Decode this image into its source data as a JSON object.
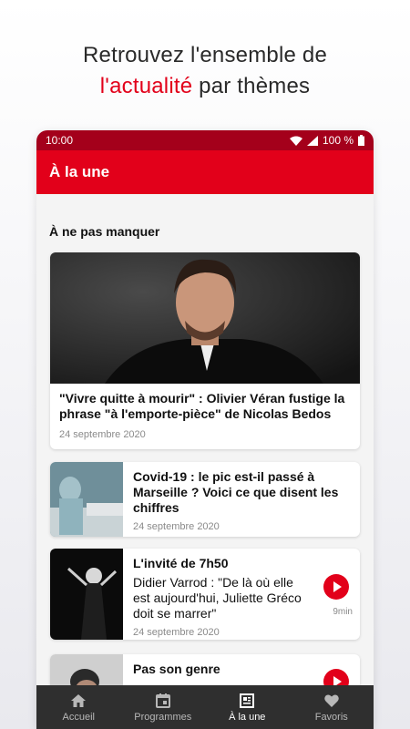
{
  "promo": {
    "line1": "Retrouvez l'ensemble de",
    "accent": "l'actualité",
    "line2_rest": " par thèmes"
  },
  "statusbar": {
    "time": "10:00",
    "battery": "100 %"
  },
  "appbar": {
    "title": "À la une"
  },
  "section": {
    "title": "À ne pas manquer"
  },
  "hero": {
    "title": "\"Vivre quitte à mourir\" : Olivier Véran fustige la phrase \"à l'emporte-pièce\" de Nicolas Bedos",
    "date": "24 septembre 2020"
  },
  "cards": [
    {
      "title": "Covid-19 : le pic est-il passé à Marseille ? Voici ce que disent les chiffres",
      "date": "24 septembre 2020"
    },
    {
      "title": "L'invité de 7h50",
      "subtitle": "Didier Varrod : \"De là où elle est aujourd'hui, Juliette Gréco doit se marrer\"",
      "date": "24 septembre 2020",
      "duration": "9min"
    },
    {
      "title": "Pas son genre"
    }
  ],
  "nav": [
    {
      "label": "Accueil",
      "icon": "home-icon"
    },
    {
      "label": "Programmes",
      "icon": "calendar-icon"
    },
    {
      "label": "À la une",
      "icon": "newspaper-icon",
      "active": true
    },
    {
      "label": "Favoris",
      "icon": "heart-icon"
    }
  ],
  "colors": {
    "brand_red": "#e2001a",
    "status_red": "#a4001b",
    "nav_bg": "#2f2f2f"
  }
}
